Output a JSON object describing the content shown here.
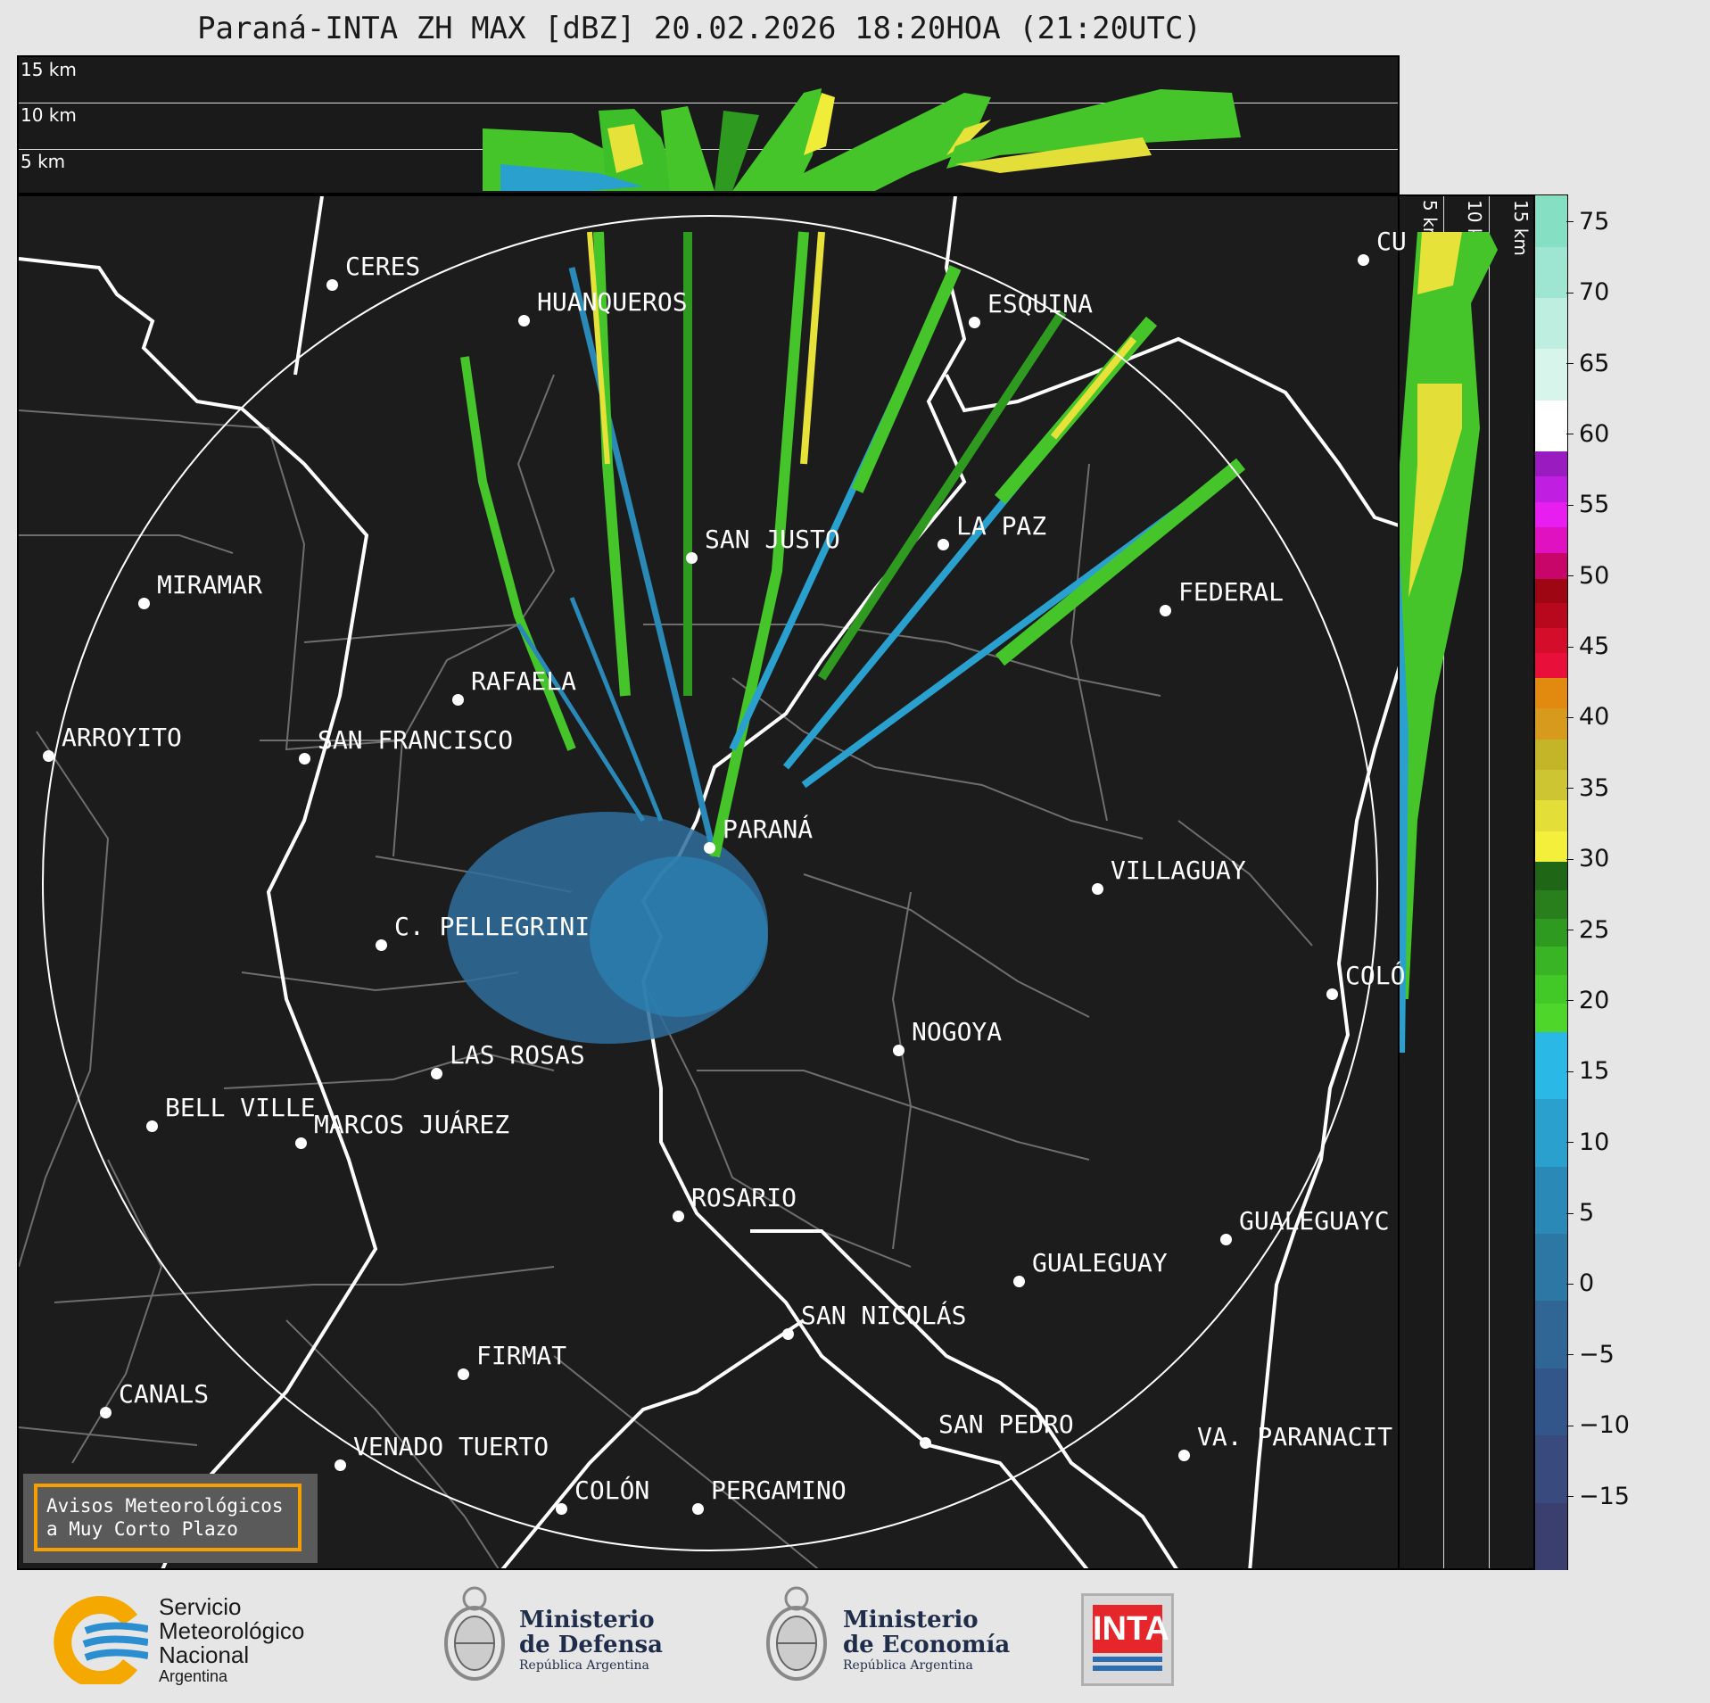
{
  "title": "Paraná-INTA ZH MAX [dBZ] 20.02.2026 18:20HOA (21:20UTC)",
  "top_section": {
    "height_labels": [
      "15 km",
      "10 km",
      "5 km"
    ]
  },
  "side_section": {
    "height_labels": [
      "5 km",
      "10 km",
      "15 km"
    ]
  },
  "colorbar": {
    "ticks": [
      "75",
      "70",
      "65",
      "60",
      "55",
      "50",
      "45",
      "40",
      "35",
      "30",
      "25",
      "20",
      "15",
      "10",
      "5",
      "0",
      "−5",
      "−10",
      "−15"
    ],
    "range": [
      -20,
      77
    ],
    "colors": [
      {
        "from": -20,
        "to": 18,
        "colors": [
          "#3b3f70",
          "#384a7e",
          "#33568a",
          "#2f6696",
          "#2c77a4",
          "#2a89b6",
          "#2aa0cf",
          "#2ab8e6"
        ]
      },
      {
        "from": 18,
        "to": 30,
        "colors": [
          "#4ed62b",
          "#43c927",
          "#38b424",
          "#2f9a20",
          "#287f1c",
          "#1f6616"
        ]
      },
      {
        "from": 30,
        "to": 43,
        "colors": [
          "#f3ef3a",
          "#e3df38",
          "#cdc632",
          "#c3b428",
          "#d89a1c",
          "#e28a10"
        ]
      },
      {
        "from": 43,
        "to": 50,
        "colors": [
          "#e8103a",
          "#d40d2a",
          "#b8081e",
          "#9e0614"
        ]
      },
      {
        "from": 50,
        "to": 59,
        "colors": [
          "#c8066a",
          "#e011c0",
          "#e81ef0",
          "#c01ee0",
          "#9a1cc0"
        ]
      },
      {
        "from": 59,
        "to": 77,
        "colors": [
          "#ffffff",
          "#d8f5ec",
          "#bdeee0",
          "#9fe6d2",
          "#84dfc3"
        ]
      }
    ]
  },
  "cities": [
    {
      "name": "CERES"
    },
    {
      "name": "HUANQUEROS"
    },
    {
      "name": "ESQUINA"
    },
    {
      "name": "CU"
    },
    {
      "name": "SAN JUSTO"
    },
    {
      "name": "LA PAZ"
    },
    {
      "name": "MIRAMAR"
    },
    {
      "name": "FEDERAL"
    },
    {
      "name": "RAFAELA"
    },
    {
      "name": "ARROYITO"
    },
    {
      "name": "SAN FRANCISCO"
    },
    {
      "name": "PARANÁ"
    },
    {
      "name": "VILLAGUAY"
    },
    {
      "name": "C. PELLEGRINI"
    },
    {
      "name": "COLÓ"
    },
    {
      "name": "NOGOYA"
    },
    {
      "name": "LAS ROSAS"
    },
    {
      "name": "BELL VILLE"
    },
    {
      "name": "MARCOS JUÁREZ"
    },
    {
      "name": "ROSARIO"
    },
    {
      "name": "GUALEGUAYC"
    },
    {
      "name": "GUALEGUAY"
    },
    {
      "name": "SAN NICOLÁS"
    },
    {
      "name": "FIRMAT"
    },
    {
      "name": "CANALS"
    },
    {
      "name": "SAN PEDRO"
    },
    {
      "name": "VA. PARANACIT"
    },
    {
      "name": "VENADO TUERTO"
    },
    {
      "name": "COLÓN"
    },
    {
      "name": "PERGAMINO"
    }
  ],
  "notice": {
    "line1": "Avisos Meteorológicos",
    "line2": "a Muy Corto Plazo"
  },
  "logos": {
    "smn": {
      "line1": "Servicio",
      "line2": "Meteorológico",
      "line3": "Nacional",
      "line4": "Argentina"
    },
    "defensa": {
      "line1": "Ministerio",
      "line2": "de Defensa",
      "line3": "República Argentina"
    },
    "economia": {
      "line1": "Ministerio",
      "line2": "de Economía",
      "line3": "República Argentina"
    },
    "inta": {
      "text": "INTA"
    }
  }
}
